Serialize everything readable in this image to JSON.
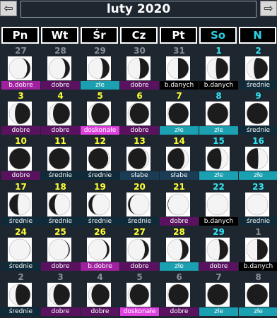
{
  "header": {
    "title": "luty 2020",
    "prev_icon": "arrow-left-icon",
    "next_icon": "arrow-right-icon"
  },
  "weekdays": [
    "Pn",
    "Wt",
    "Śr",
    "Cz",
    "Pt",
    "So",
    "N"
  ],
  "rating_colors": {
    "b.dobre": "#a020a0",
    "dobre": "#5a1260",
    "doskonałe": "#e040e0",
    "złe": "#1aa0b0",
    "średnie": "#0f2a38",
    "b.danych": "#000000",
    "słabe": "#1a3c54"
  },
  "cells": [
    {
      "day": "27",
      "tone": "oth",
      "phase": 0.85,
      "waxing": false,
      "rating": "b.dobre"
    },
    {
      "day": "28",
      "tone": "oth",
      "phase": 0.78,
      "waxing": false,
      "rating": "dobre"
    },
    {
      "day": "29",
      "tone": "oth",
      "phase": 0.68,
      "waxing": false,
      "rating": "złe"
    },
    {
      "day": "30",
      "tone": "oth",
      "phase": 0.58,
      "waxing": false,
      "rating": "dobre"
    },
    {
      "day": "31",
      "tone": "oth",
      "phase": 0.5,
      "waxing": false,
      "rating": "b.danych"
    },
    {
      "day": "1",
      "tone": "curwk",
      "phase": 0.42,
      "waxing": false,
      "rating": "b.danych"
    },
    {
      "day": "2",
      "tone": "curwk",
      "phase": 0.34,
      "waxing": false,
      "rating": "średnie"
    },
    {
      "day": "3",
      "tone": "cur",
      "phase": 0.27,
      "waxing": false,
      "rating": "dobre"
    },
    {
      "day": "4",
      "tone": "cur",
      "phase": 0.2,
      "waxing": false,
      "rating": "dobre"
    },
    {
      "day": "5",
      "tone": "cur",
      "phase": 0.14,
      "waxing": false,
      "rating": "doskonałe"
    },
    {
      "day": "6",
      "tone": "cur",
      "phase": 0.09,
      "waxing": false,
      "rating": "dobre"
    },
    {
      "day": "7",
      "tone": "cur",
      "phase": 0.05,
      "waxing": false,
      "rating": "złe"
    },
    {
      "day": "8",
      "tone": "curwk",
      "phase": 0.02,
      "waxing": false,
      "rating": "złe"
    },
    {
      "day": "9",
      "tone": "curwk",
      "phase": 0.01,
      "waxing": false,
      "rating": "średnie"
    },
    {
      "day": "10",
      "tone": "cur",
      "phase": 0.0,
      "waxing": false,
      "rating": "dobre"
    },
    {
      "day": "11",
      "tone": "cur",
      "phase": 0.02,
      "waxing": true,
      "rating": "średnie"
    },
    {
      "day": "12",
      "tone": "cur",
      "phase": 0.06,
      "waxing": true,
      "rating": "średnie"
    },
    {
      "day": "13",
      "tone": "cur",
      "phase": 0.12,
      "waxing": true,
      "rating": "słabe"
    },
    {
      "day": "14",
      "tone": "cur",
      "phase": 0.2,
      "waxing": true,
      "rating": "słabe"
    },
    {
      "day": "15",
      "tone": "curwk",
      "phase": 0.32,
      "waxing": true,
      "rating": "złe"
    },
    {
      "day": "16",
      "tone": "curwk",
      "phase": 0.45,
      "waxing": true,
      "rating": "złe"
    },
    {
      "day": "17",
      "tone": "cur",
      "phase": 0.6,
      "waxing": true,
      "rating": "średnie"
    },
    {
      "day": "18",
      "tone": "cur",
      "phase": 0.72,
      "waxing": true,
      "rating": "średnie"
    },
    {
      "day": "19",
      "tone": "cur",
      "phase": 0.82,
      "waxing": true,
      "rating": "średnie"
    },
    {
      "day": "20",
      "tone": "cur",
      "phase": 0.9,
      "waxing": true,
      "rating": "średnie"
    },
    {
      "day": "21",
      "tone": "cur",
      "phase": 0.97,
      "waxing": true,
      "rating": "dobre"
    },
    {
      "day": "22",
      "tone": "curwk",
      "phase": 1.0,
      "waxing": true,
      "rating": "b.danych"
    },
    {
      "day": "23",
      "tone": "curwk",
      "phase": 1.0,
      "waxing": true,
      "rating": "średnie"
    },
    {
      "day": "24",
      "tone": "cur",
      "phase": 0.98,
      "waxing": false,
      "rating": "średnie"
    },
    {
      "day": "25",
      "tone": "cur",
      "phase": 0.94,
      "waxing": false,
      "rating": "dobre"
    },
    {
      "day": "26",
      "tone": "cur",
      "phase": 0.88,
      "waxing": false,
      "rating": "b.dobre"
    },
    {
      "day": "27",
      "tone": "cur",
      "phase": 0.8,
      "waxing": false,
      "rating": "dobre"
    },
    {
      "day": "28",
      "tone": "cur",
      "phase": 0.7,
      "waxing": false,
      "rating": "złe"
    },
    {
      "day": "29",
      "tone": "curwk",
      "phase": 0.6,
      "waxing": false,
      "rating": "dobre"
    },
    {
      "day": "1",
      "tone": "oth",
      "phase": 0.5,
      "waxing": false,
      "rating": "b.danych"
    },
    {
      "day": "2",
      "tone": "oth",
      "phase": 0.3,
      "waxing": false,
      "rating": "średnie"
    },
    {
      "day": "3",
      "tone": "oth",
      "phase": 0.22,
      "waxing": false,
      "rating": "dobre"
    },
    {
      "day": "4",
      "tone": "oth",
      "phase": 0.15,
      "waxing": false,
      "rating": "dobre"
    },
    {
      "day": "5",
      "tone": "oth",
      "phase": 0.09,
      "waxing": false,
      "rating": "doskonałe"
    },
    {
      "day": "6",
      "tone": "oth",
      "phase": 0.05,
      "waxing": false,
      "rating": "dobre"
    },
    {
      "day": "7",
      "tone": "oth",
      "phase": 0.02,
      "waxing": false,
      "rating": "złe"
    },
    {
      "day": "8",
      "tone": "oth",
      "phase": 0.01,
      "waxing": false,
      "rating": "złe"
    }
  ]
}
